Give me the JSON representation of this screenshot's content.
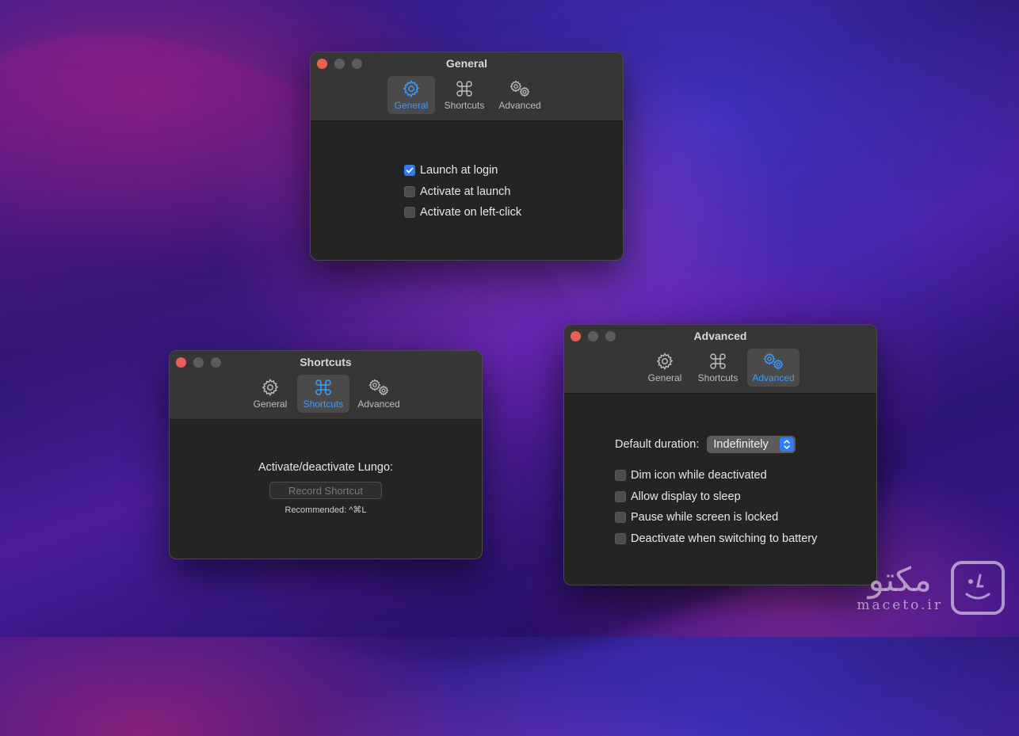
{
  "tabs": {
    "general": "General",
    "shortcuts": "Shortcuts",
    "advanced": "Advanced"
  },
  "general_window": {
    "title": "General",
    "options": [
      {
        "label": "Launch at login",
        "checked": true
      },
      {
        "label": "Activate at launch",
        "checked": false
      },
      {
        "label": "Activate on left-click",
        "checked": false
      }
    ]
  },
  "shortcuts_window": {
    "title": "Shortcuts",
    "prompt": "Activate/deactivate Lungo:",
    "record_label": "Record Shortcut",
    "recommended": "Recommended: ^⌘L"
  },
  "advanced_window": {
    "title": "Advanced",
    "duration_label": "Default duration:",
    "duration_value": "Indefinitely",
    "options": [
      {
        "label": "Dim icon while deactivated",
        "checked": false
      },
      {
        "label": "Allow display to sleep",
        "checked": false
      },
      {
        "label": "Pause while screen is locked",
        "checked": false
      },
      {
        "label": "Deactivate when switching to battery",
        "checked": false
      }
    ]
  },
  "watermark": {
    "main": "مکتو",
    "sub": "maceto.ir"
  },
  "colors": {
    "accent": "#2f7cf6",
    "active_tab_text": "#3d9bff",
    "window_bg": "#242424",
    "titlebar_bg": "#363636"
  },
  "icons": {
    "general": "gear-icon",
    "shortcuts": "command-icon",
    "advanced": "gears-icon"
  }
}
